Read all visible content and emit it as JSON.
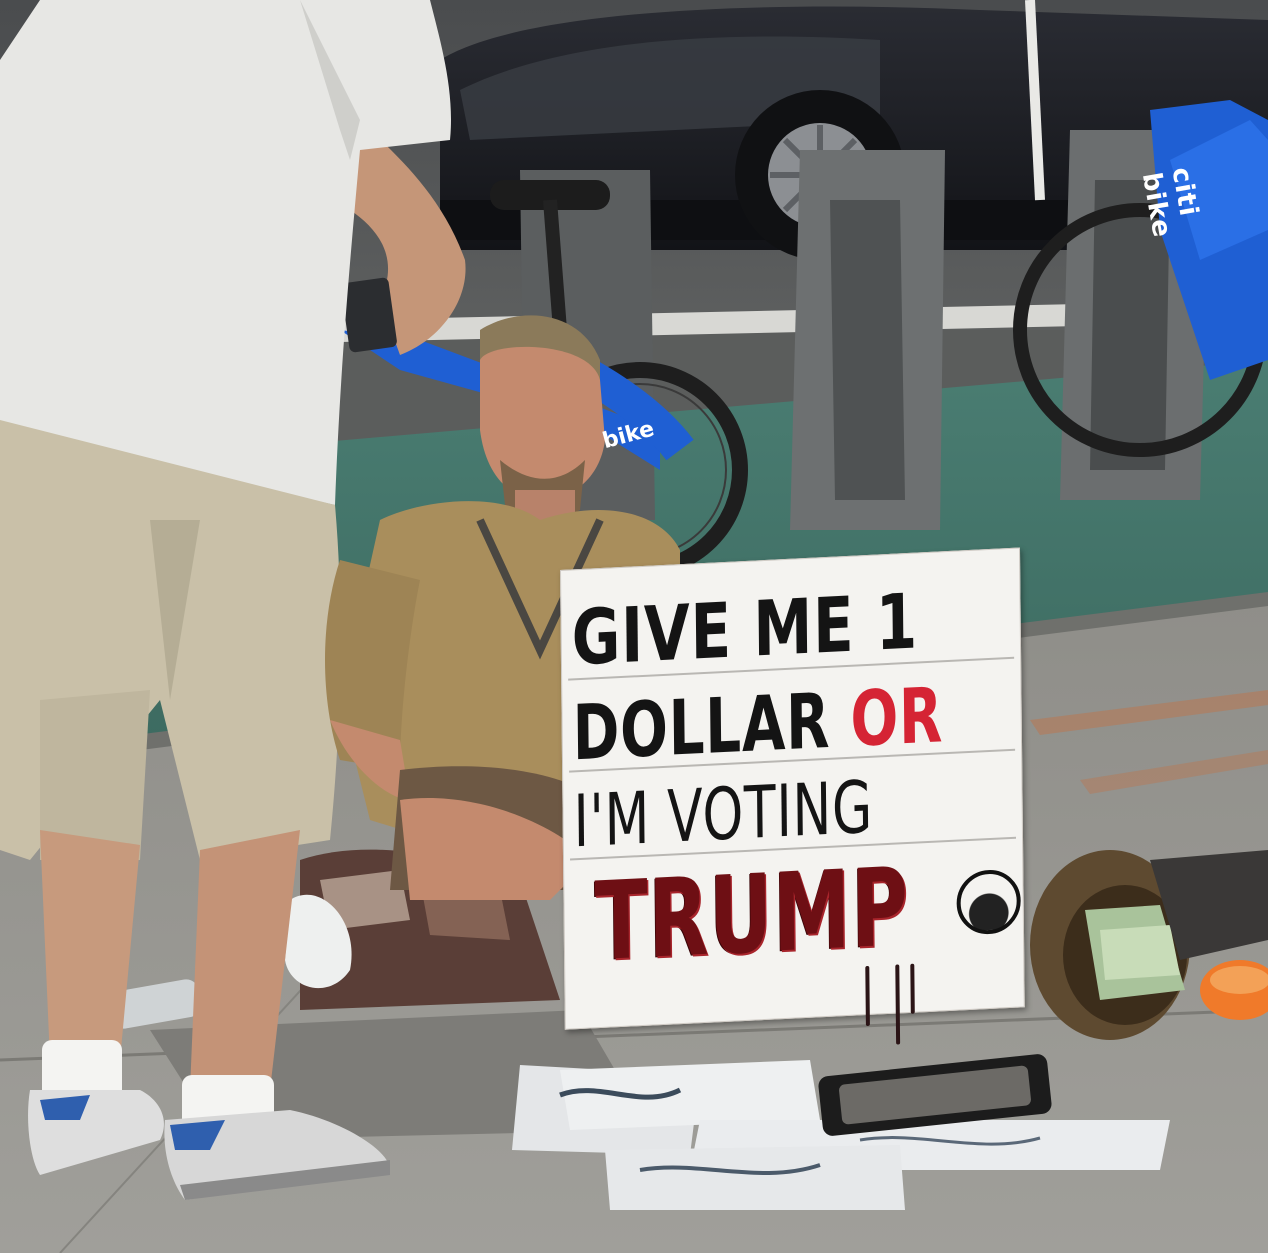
{
  "image": {
    "kind": "street photograph",
    "subjects": [
      "standing-man",
      "seated-man",
      "sign",
      "bike-share-dock",
      "car"
    ]
  },
  "sign": {
    "line1": "GIVE ME 1",
    "line2_main": "DOLLAR",
    "line2_accent": "OR",
    "line3": "I'M VOTING",
    "line4": "TRUMP",
    "colors": {
      "ink": "#141414",
      "accent": "#d52434",
      "trump_ink": "#6e0f14"
    }
  },
  "bike": {
    "brand_text": "citi bike",
    "brand_text_secondary": "bike",
    "color": "#1f5fd3"
  },
  "colors": {
    "sidewalk": "#8e8d88",
    "bike_lane": "#3f6f66",
    "shirt_tan": "#a98e5c",
    "shorts_khaki": "#c9c0a8"
  }
}
